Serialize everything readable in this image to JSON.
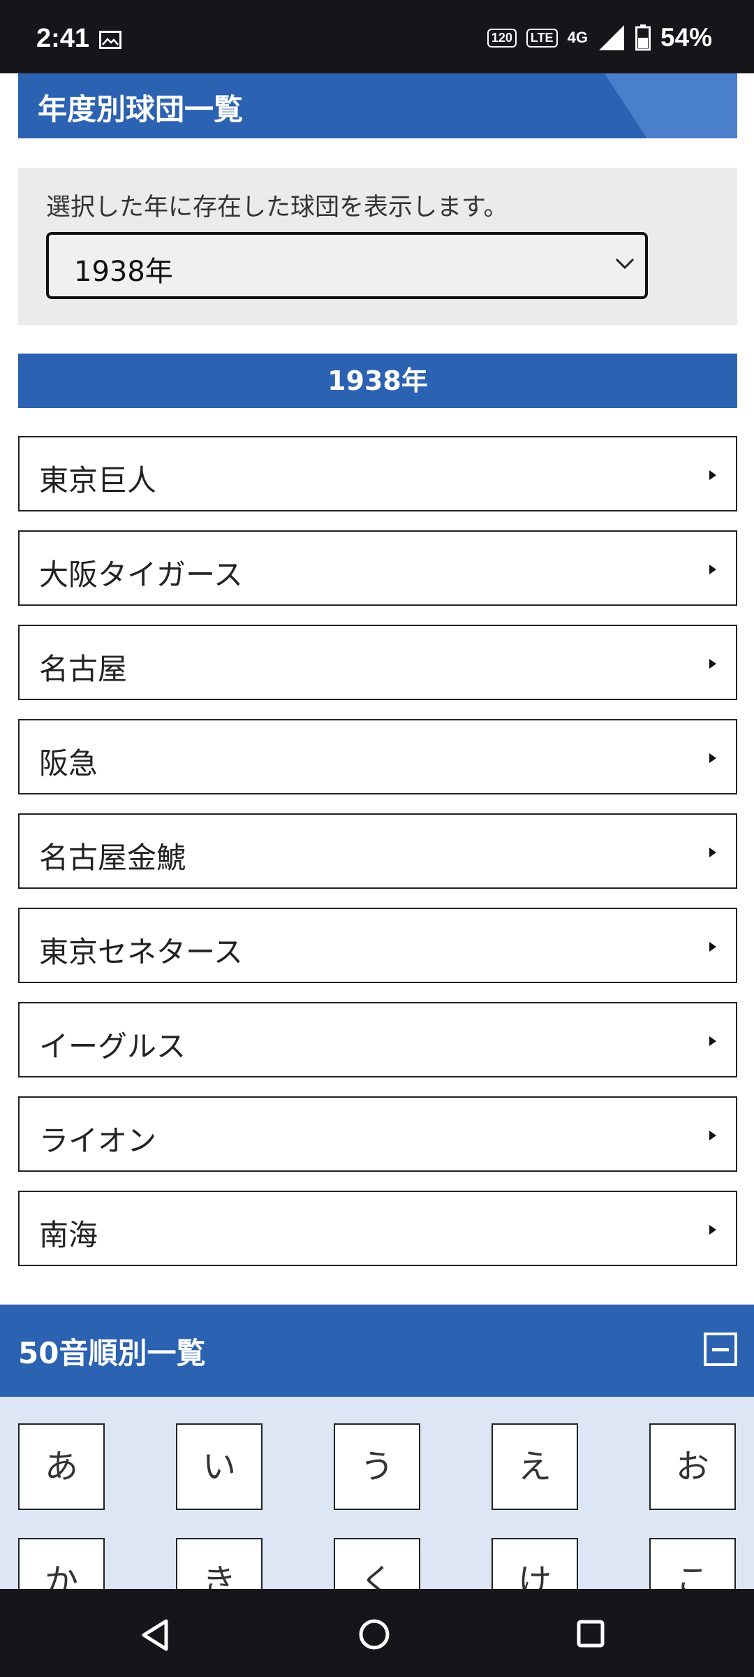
{
  "status_bar": {
    "time": "2:41",
    "icons": [
      "gallery-icon",
      "120hz-icon",
      "volte-icon",
      "4g-icon",
      "signal-icon",
      "battery-icon"
    ],
    "refresh_label": "120",
    "volte_label": "LTE",
    "network_label": "4G",
    "battery": "54%"
  },
  "banner": {
    "title": "年度別球団一覧"
  },
  "selector": {
    "description": "選択した年に存在した球団を表示します。",
    "selected_year": "1938年"
  },
  "year_heading": "1938年",
  "teams": [
    {
      "name": "東京巨人"
    },
    {
      "name": "大阪タイガース"
    },
    {
      "name": "名古屋"
    },
    {
      "name": "阪急"
    },
    {
      "name": "名古屋金鯱"
    },
    {
      "name": "東京セネタース"
    },
    {
      "name": "イーグルス"
    },
    {
      "name": "ライオン"
    },
    {
      "name": "南海"
    }
  ],
  "kana_section": {
    "title": "50音順別一覧",
    "row1": [
      "あ",
      "い",
      "う",
      "え",
      "お"
    ],
    "row2": [
      "か",
      "き",
      "く",
      "け",
      "こ"
    ]
  },
  "colors": {
    "brand_blue": "#2b62b1",
    "banner_accent": "#4a7fcc",
    "kana_bg": "#dce6f5",
    "selector_bg": "#ebebeb"
  }
}
